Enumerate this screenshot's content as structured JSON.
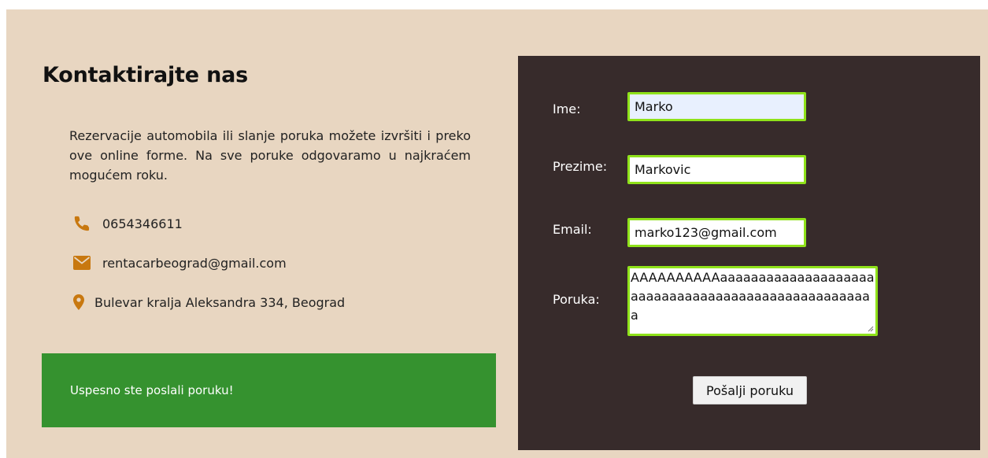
{
  "contact": {
    "title": "Kontaktirajte nas",
    "description": "Rezervacije automobila ili slanje poruka možete izvršiti i preko ove online forme. Na sve poruke odgovaramo u najkraćem mogućem roku.",
    "phone": "0654346611",
    "email": "rentacarbeograd@gmail.com",
    "address": "Bulevar kralja Aleksandra 334, Beograd",
    "icons": {
      "phone": "phone-icon",
      "email": "envelope-icon",
      "address": "map-marker-icon"
    },
    "icon_color": "#c8780f"
  },
  "alert": {
    "message": "Uspesno ste poslali poruku!",
    "color": "#35922f"
  },
  "form": {
    "first_name": {
      "label": "Ime:",
      "value": "Marko"
    },
    "last_name": {
      "label": "Prezime:",
      "value": "Markovic"
    },
    "email": {
      "label": "Email:",
      "value": "marko123@gmail.com"
    },
    "message": {
      "label": "Poruka:",
      "value": "AAAAAAAAAAaaaaaaaaaaaaaaaaaaaaaaaaaaaaaaaaaaaaaaaaaaaaaaaaaaaa"
    },
    "submit_label": "Pošalji poruku",
    "panel_color": "#372b2b",
    "field_border_color": "#8fe21a"
  },
  "page": {
    "background": "#e8d6c1"
  }
}
